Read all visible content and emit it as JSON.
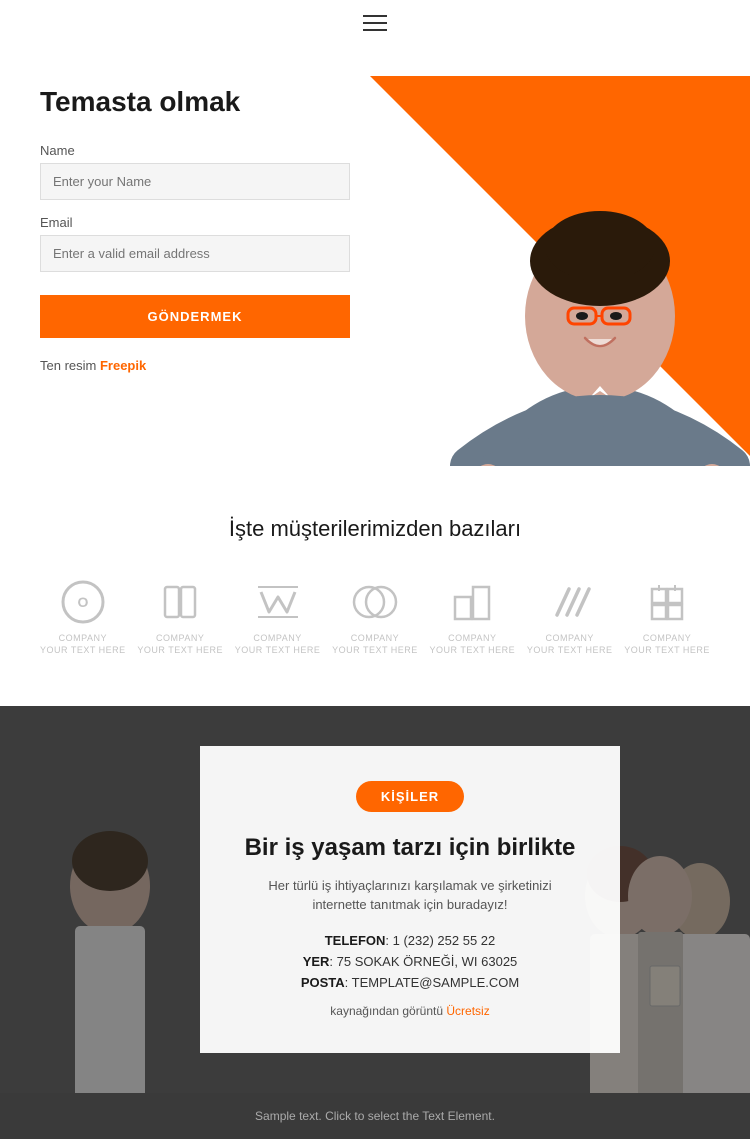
{
  "header": {
    "menu_icon": "hamburger-icon"
  },
  "hero": {
    "title": "Temasta olmak",
    "name_label": "Name",
    "name_placeholder": "Enter your Name",
    "email_label": "Email",
    "email_placeholder": "Enter a valid email address",
    "submit_label": "GÖNDERMEK",
    "credit_prefix": "Ten resim ",
    "credit_link_text": "Freepik",
    "credit_link_url": "#"
  },
  "clients": {
    "title": "İşte müşterilerimizden bazıları",
    "logos": [
      {
        "id": "logo1",
        "label": "COMPANY\nYOUR TEXT HERE"
      },
      {
        "id": "logo2",
        "label": "COMPANY\nYOUR TEXT HERE"
      },
      {
        "id": "logo3",
        "label": "COMPANY\nYOUR TEXT HERE"
      },
      {
        "id": "logo4",
        "label": "COMPANY\nYOUR TEXT HERE"
      },
      {
        "id": "logo5",
        "label": "COMPANY\nYOUR TEXT HERE"
      },
      {
        "id": "logo6",
        "label": "COMPANY\nYOUR TEXT HERE"
      },
      {
        "id": "logo7",
        "label": "COMPANY\nYOUR TEXT HERE"
      }
    ]
  },
  "team": {
    "badge": "KİŞİLER",
    "title": "Bir iş yaşam tarzı için birlikte",
    "description": "Her türlü iş ihtiyaçlarınızı karşılamak ve şirketinizi internette tanıtmak için buradayız!",
    "phone_label": "TELEFON",
    "phone_value": "1 (232) 252 55 22",
    "location_label": "YER",
    "location_value": "75 SOKAK ÖRNEĞİ, WI 63025",
    "email_label": "POSTA",
    "email_value": "TEMPLATE@SAMPLE.COM",
    "source_prefix": "kaynağından görüntü ",
    "source_link": "Ücretsiz",
    "source_url": "#"
  },
  "footer": {
    "text": "Sample text. Click to select the Text Element."
  }
}
